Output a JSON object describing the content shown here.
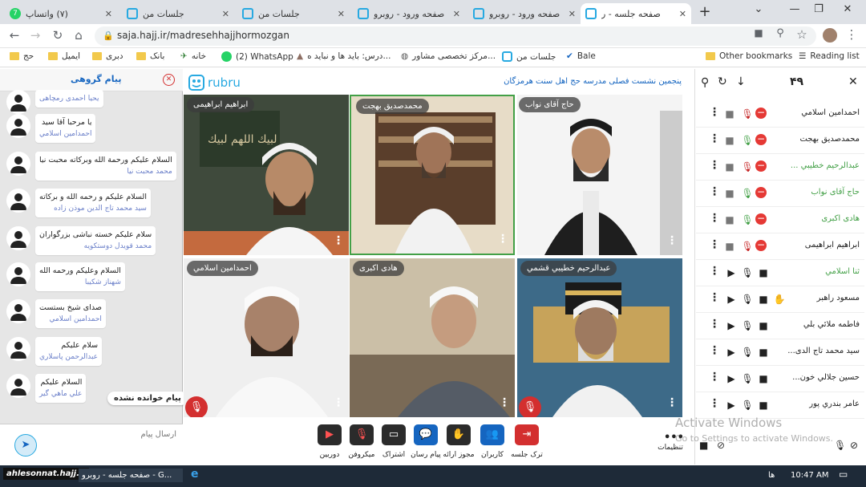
{
  "browser": {
    "tabs": [
      {
        "title": "(۷) واتساپ",
        "icon": "whatsapp-icon",
        "badge": "7",
        "active": false
      },
      {
        "title": "جلسات من",
        "icon": "rubru-icon",
        "active": false
      },
      {
        "title": "جلسات من",
        "icon": "rubru-icon",
        "active": false
      },
      {
        "title": "صفحه ورود - روبرو",
        "icon": "rubru-icon",
        "active": false
      },
      {
        "title": "صفحه ورود - روبرو",
        "icon": "rubru-icon",
        "active": false
      },
      {
        "title": "صفحه جلسه - ر",
        "icon": "rubru-icon",
        "active": true
      }
    ],
    "new_tab": "+",
    "url": "saja.hajj.ir/madresehhajjhormozgan",
    "bookmarks": [
      {
        "label": "حج",
        "icon": "folder-icon"
      },
      {
        "label": "ایمیل",
        "icon": "folder-icon"
      },
      {
        "label": "دبری",
        "icon": "folder-icon"
      },
      {
        "label": "بانک",
        "icon": "folder-icon"
      },
      {
        "label": "خانه",
        "icon": "home-icon"
      },
      {
        "label": "(2) WhatsApp",
        "icon": "whatsapp-icon"
      },
      {
        "label": "درس: باید ها و نباید ه...",
        "icon": "page-icon"
      },
      {
        "label": "مرکز تخصصی مشاور...",
        "icon": "globe-icon"
      },
      {
        "label": "جلسات من",
        "icon": "rubru-icon"
      },
      {
        "label": "Bale",
        "icon": "bale-icon"
      }
    ],
    "other_bookmarks": "Other bookmarks",
    "reading_list": "Reading list"
  },
  "chat": {
    "title": "پیام گروهی",
    "messages": [
      {
        "text": "",
        "sender": "یحیا احمدی رمچاهی"
      },
      {
        "text": "یا مرحبا آقا سید",
        "sender": "احمدامین اسلامي"
      },
      {
        "text": "السلام علیکم ورحمة الله وبرکاته محبت نیا",
        "sender": "محمد محبت نیا"
      },
      {
        "text": "السلام علیکم و رحمه الله و برکاته",
        "sender": "سید محمد تاج الدین موذن زاده"
      },
      {
        "text": "سلام علیکم خسته نباشی بزرگواران",
        "sender": "محمد قویدل دوستکویه"
      },
      {
        "text": "السلام وعلیکم ورحمه الله",
        "sender": "شهناز شکیبا"
      },
      {
        "text": "صدای شیخ بستست",
        "sender": "احمدامین اسلامي"
      },
      {
        "text": "سلام علیکم",
        "sender": "عبدالرحمن پاسلاري"
      },
      {
        "text": "السلام علیکم",
        "sender": "علي ماهي گیر"
      }
    ],
    "unread_badge": "پیام خوانده نشده",
    "input_placeholder": "ارسال پیام"
  },
  "session": {
    "brand": "rubru",
    "title": "پنجمین نشست فصلی مدرسه حج اهل سنت هرمزگان",
    "participants_video": [
      {
        "name": "ابراهیم ابراهیمی",
        "muted": true
      },
      {
        "name": "محمدصدیق بهجت",
        "muted": false,
        "active": true
      },
      {
        "name": "حاج آقای نواب",
        "muted": false
      },
      {
        "name": "احمدامین اسلامي",
        "muted": true
      },
      {
        "name": "هادی اکبری",
        "muted": false
      },
      {
        "name": "عبدالرحیم خطیبي قشمي",
        "muted": true
      }
    ]
  },
  "controls": [
    {
      "label": "ترک جلسه",
      "icon": "leave-icon"
    },
    {
      "label": "کاربران",
      "icon": "users-icon"
    },
    {
      "label": "مجوز ارائه",
      "icon": "hand-icon"
    },
    {
      "label": "پیام رسان",
      "icon": "chat-icon"
    },
    {
      "label": "اشتراک",
      "icon": "share-screen-icon"
    },
    {
      "label": "میکروفن",
      "icon": "mic-off-icon"
    },
    {
      "label": "دوربین",
      "icon": "camera-off-icon"
    },
    {
      "label": "تنظیمات",
      "icon": "more-icon"
    }
  ],
  "participants": {
    "count": "۴۹",
    "list": [
      {
        "name": "احمدامین اسلامي",
        "color": "#222222",
        "mode": "host",
        "mic": "off"
      },
      {
        "name": "محمدصدیق بهجت",
        "color": "#222222",
        "mode": "host",
        "mic": "on"
      },
      {
        "name": "عبدالرحیم خطیبي ...",
        "color": "#43a047",
        "mode": "host",
        "mic": "off"
      },
      {
        "name": "حاج آقای نواب",
        "color": "#43a047",
        "mode": "host",
        "mic": "on"
      },
      {
        "name": "هادی اکبری",
        "color": "#43a047",
        "mode": "host",
        "mic": "on"
      },
      {
        "name": "ابراهیم ابراهیمی",
        "color": "#222222",
        "mode": "host",
        "mic": "off"
      },
      {
        "name": "ثنا اسلامي",
        "color": "#43a047",
        "mode": "user"
      },
      {
        "name": "مسعود راهبر",
        "color": "#222222",
        "mode": "user",
        "hand": true
      },
      {
        "name": "فاطمه ملائي بلي",
        "color": "#222222",
        "mode": "user"
      },
      {
        "name": "سید محمد تاج الدی...",
        "color": "#222222",
        "mode": "user"
      },
      {
        "name": "حسین جلالي خون...",
        "color": "#222222",
        "mode": "user"
      },
      {
        "name": "عامر بندري پور",
        "color": "#222222",
        "mode": "user"
      }
    ]
  },
  "watermark": {
    "line1": "Activate Windows",
    "line2": "Go to Settings to activate Windows."
  },
  "taskbar": {
    "site_badge": "ahlesonnat.hajj.ir",
    "app_title": "صفحه جلسه - روبرو - G...",
    "lang": "ها",
    "time": "10:47 AM"
  },
  "colors": {
    "accent": "#1565c0",
    "danger": "#d32f2f",
    "online": "#43a047",
    "sender": "#6a7fc9",
    "rubru": "#27a9e1"
  }
}
